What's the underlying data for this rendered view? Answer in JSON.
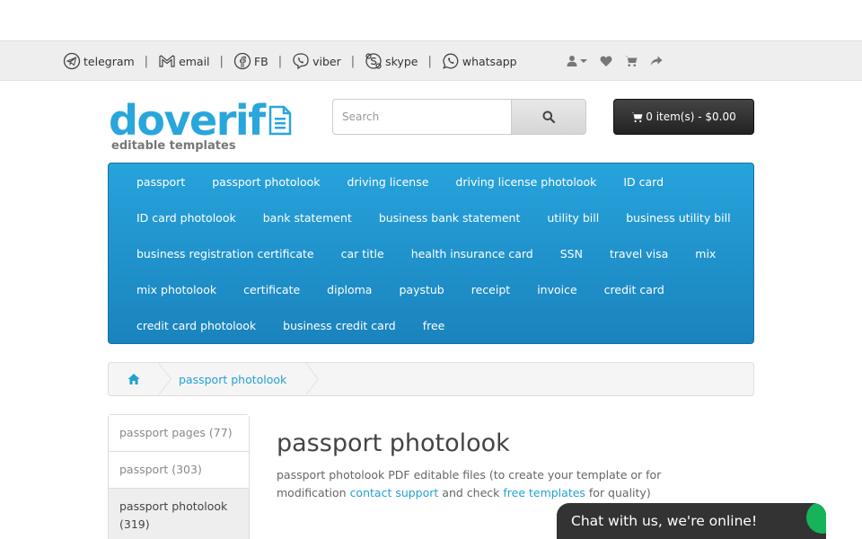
{
  "topbar": {
    "contacts": [
      {
        "label": "telegram",
        "icon": "telegram-icon"
      },
      {
        "label": "email",
        "icon": "gmail-icon"
      },
      {
        "label": "FB",
        "icon": "facebook-icon"
      },
      {
        "label": "viber",
        "icon": "viber-icon"
      },
      {
        "label": "skype",
        "icon": "skype-icon"
      },
      {
        "label": "whatsapp",
        "icon": "whatsapp-icon"
      }
    ],
    "separator": "|"
  },
  "header": {
    "logo_text": "doverif",
    "logo_sub": "editable templates",
    "search_placeholder": "Search",
    "cart_label": "0 item(s) - $0.00"
  },
  "menu": {
    "rows": [
      [
        "passport",
        "passport photolook",
        "driving license",
        "driving license photolook",
        "ID card"
      ],
      [
        "ID card photolook",
        "bank statement",
        "business bank statement",
        "utility bill",
        "business utility bill"
      ],
      [
        "business registration certificate",
        "car title",
        "health insurance card",
        "SSN",
        "travel visa",
        "mix"
      ],
      [
        "mix photolook",
        "certificate",
        "diploma",
        "paystub",
        "receipt",
        "invoice",
        "credit card"
      ],
      [
        "credit card photolook",
        "business credit card",
        "free"
      ]
    ]
  },
  "breadcrumb": {
    "current": "passport photolook"
  },
  "sidebar": {
    "items": [
      {
        "label": "passport pages (77)",
        "active": false
      },
      {
        "label": "passport (303)",
        "active": false
      },
      {
        "label": "passport photolook (319)",
        "active": true
      }
    ]
  },
  "content": {
    "title": "passport photolook",
    "desc_before": "passport photolook PDF editable files (to create your template or for modification ",
    "link1": "contact support",
    "desc_mid": " and check ",
    "link2": "free templates",
    "desc_after": " for quality)"
  },
  "chat": {
    "label": "Chat with us, we're online!"
  },
  "colors": {
    "accent": "#23a1d1",
    "menu_bg": "#1f94cf",
    "chat_bg": "#333333",
    "chat_status": "#16b35b"
  }
}
